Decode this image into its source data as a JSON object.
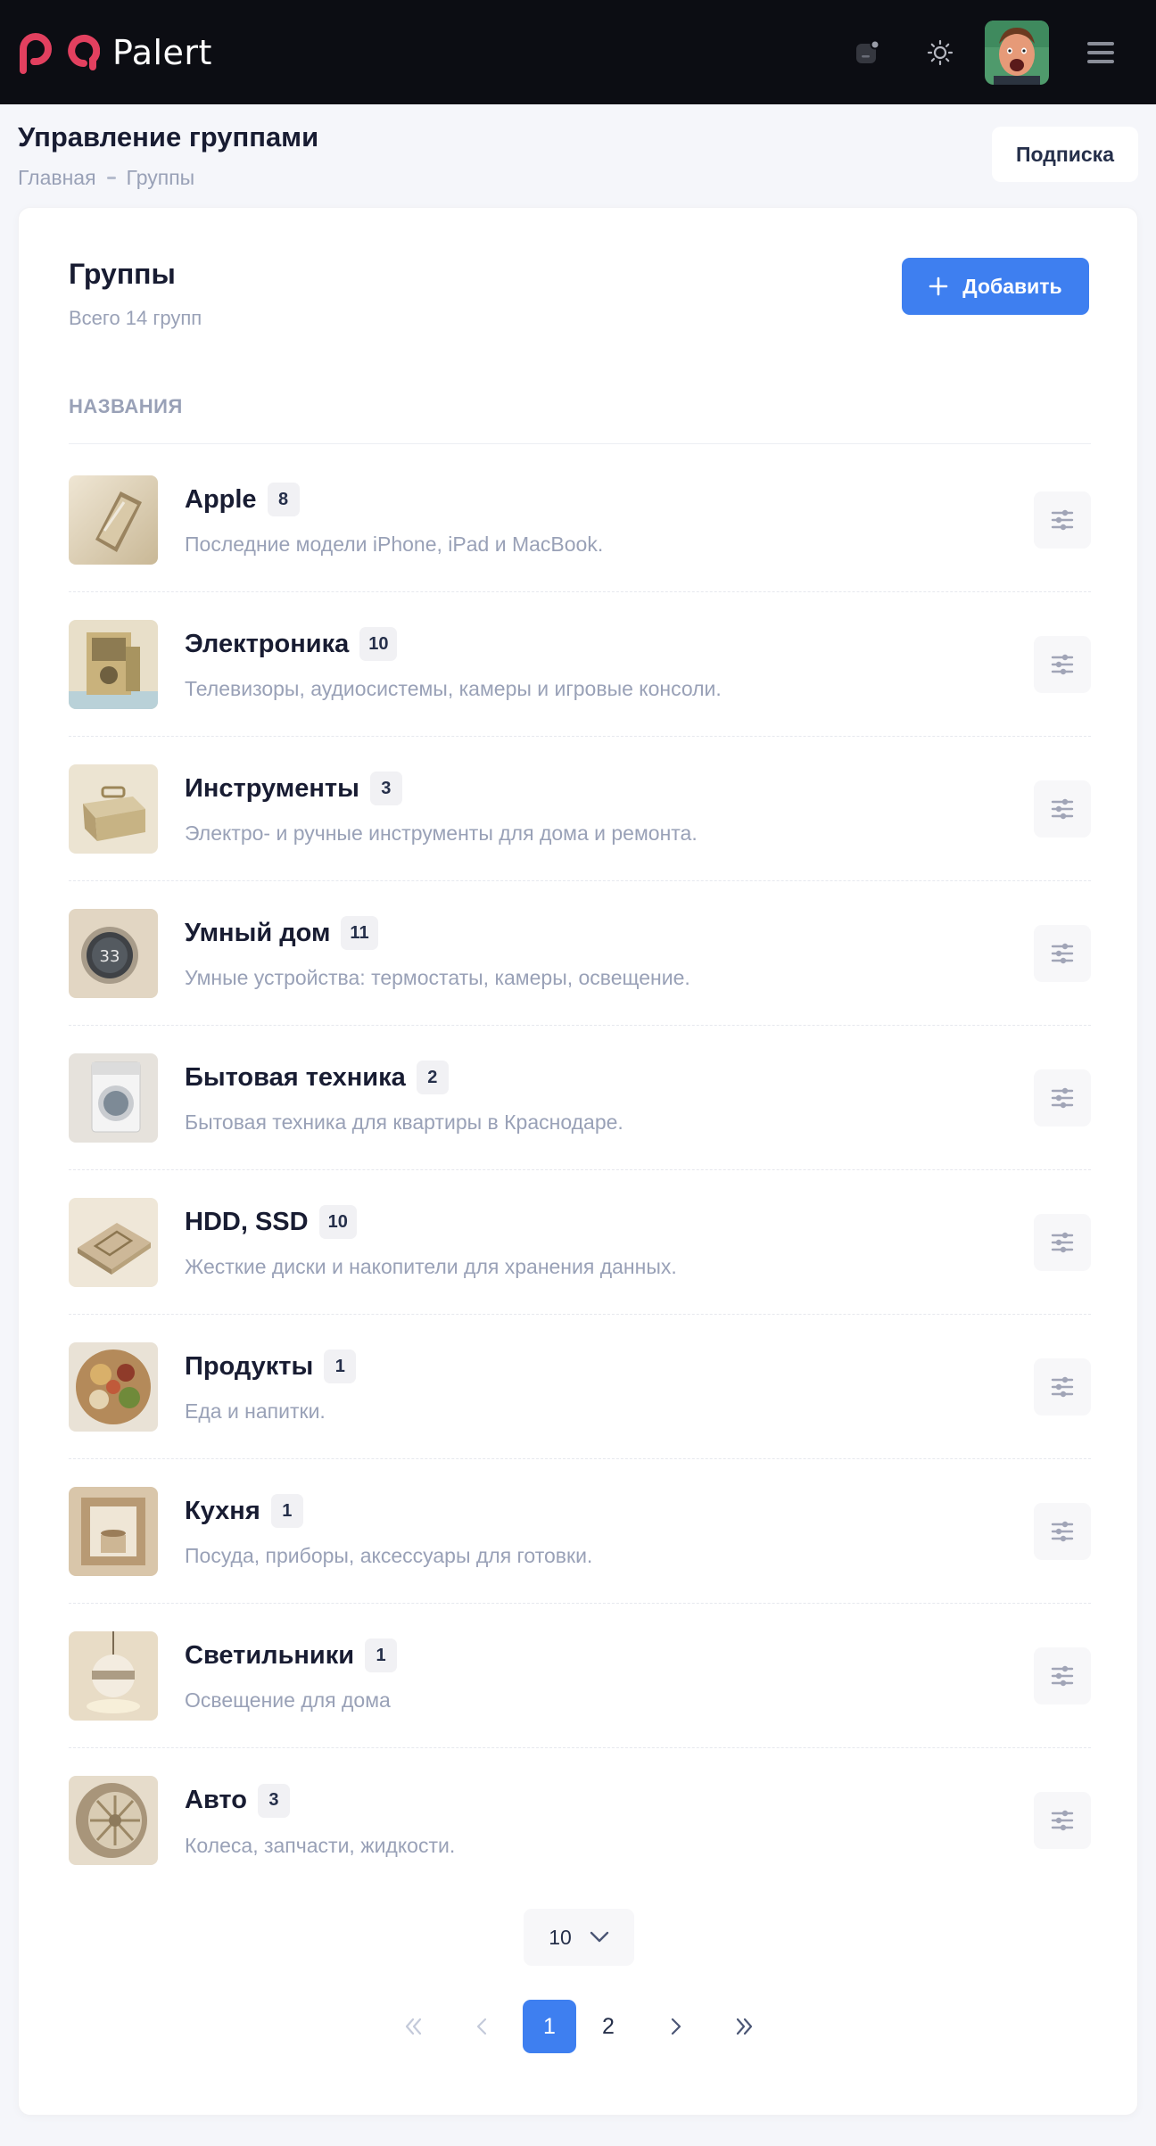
{
  "header": {
    "logo_text": "Palert",
    "brand_color": "#e2405f",
    "accent_color": "#3e7ff0"
  },
  "page": {
    "title": "Управление группами",
    "breadcrumb": [
      "Главная",
      "Группы"
    ],
    "subscription_label": "Подписка"
  },
  "card": {
    "title": "Группы",
    "subtitle": "Всего 14 групп",
    "add_label": "Добавить",
    "column_header": "НАЗВАНИЯ"
  },
  "groups": [
    {
      "name": "Apple",
      "count": "8",
      "description": "Последние модели iPhone, iPad и MacBook.",
      "icon": "phone-thumbnail"
    },
    {
      "name": "Электроника",
      "count": "10",
      "description": "Телевизоры, аудиосистемы, камеры и игровые консоли.",
      "icon": "electronics-thumbnail"
    },
    {
      "name": "Инструменты",
      "count": "3",
      "description": "Электро- и ручные инструменты для дома и ремонта.",
      "icon": "toolbox-thumbnail"
    },
    {
      "name": "Умный дом",
      "count": "11",
      "description": "Умные устройства: термостаты, камеры, освещение.",
      "icon": "thermostat-thumbnail"
    },
    {
      "name": "Бытовая техника",
      "count": "2",
      "description": "Бытовая техника для квартиры в Краснодаре.",
      "icon": "washing-machine-thumbnail"
    },
    {
      "name": "HDD, SSD",
      "count": "10",
      "description": "Жесткие диски и накопители для хранения данных.",
      "icon": "drive-thumbnail"
    },
    {
      "name": "Продукты",
      "count": "1",
      "description": "Еда и напитки.",
      "icon": "food-thumbnail"
    },
    {
      "name": "Кухня",
      "count": "1",
      "description": "Посуда, приборы, аксессуары для готовки.",
      "icon": "kitchen-thumbnail"
    },
    {
      "name": "Светильники",
      "count": "1",
      "description": "Освещение для дома",
      "icon": "lamp-thumbnail"
    },
    {
      "name": "Авто",
      "count": "3",
      "description": "Колеса, запчасти, жидкости.",
      "icon": "wheel-thumbnail"
    }
  ],
  "pagination": {
    "per_page": "10",
    "pages": [
      "1",
      "2"
    ],
    "current": "1"
  }
}
